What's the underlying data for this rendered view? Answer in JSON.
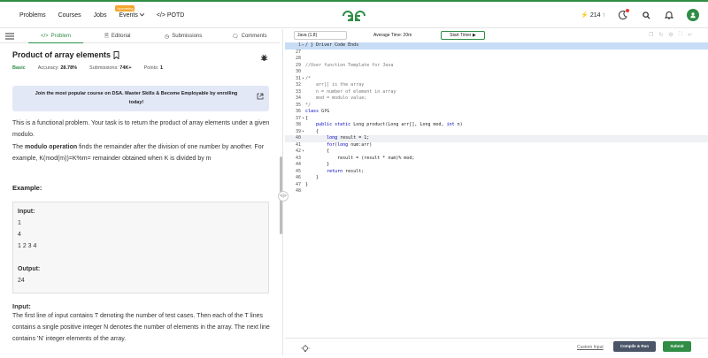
{
  "nav": {
    "items": [
      "Problems",
      "Courses",
      "Jobs"
    ],
    "events_label": "Events",
    "events_badge": "Upcoming",
    "potd_label": "POTD",
    "streak_count": "214"
  },
  "tabs": {
    "problem": "Problem",
    "editorial": "Editorial",
    "submissions": "Submissions",
    "comments": "Comments"
  },
  "problem": {
    "title": "Product of array elements",
    "difficulty": "Basic",
    "accuracy_label": "Accuracy:",
    "accuracy": "28.78%",
    "submissions_label": "Submissions:",
    "submissions": "74K+",
    "points_label": "Points:",
    "points": "1",
    "promo": "Join the most popular course on DSA. Master Skills & Become Employable by enrolling today!",
    "desc1": "This is a functional problem. Your task is to return the product of array elements under a given modulo.",
    "desc2_bold": "modulo operation",
    "desc2_pre": "The ",
    "desc2_post": " finds the remainder after the division of one number by another. For example, K(mod(m))=K%m= remainder obtained when K is divided by m",
    "example_heading": "Example:",
    "example": {
      "input_label": "Input:",
      "input_lines": [
        "1",
        "4",
        "1 2 3 4"
      ],
      "output_label": "Output:",
      "output": "24"
    },
    "input_heading": "Input:",
    "input_desc": "The first line of input contains T denoting the number of test cases. Then each of the T lines contains a single positive integer N denotes the number of elements in the array. The next line contains 'N' integer elements of the array."
  },
  "editor": {
    "language": "Java (1.8)",
    "avg_time": "Average Time: 20m",
    "timer": "Start Timer",
    "custom_input": "Custom Input",
    "compile": "Compile & Run",
    "submit": "Submit",
    "lines": [
      {
        "n": "1",
        "fold": "▸",
        "text": "/ } Driver Code Ends",
        "cls": "top"
      },
      {
        "n": "27",
        "fold": "",
        "text": ""
      },
      {
        "n": "28",
        "fold": "",
        "text": ""
      },
      {
        "n": "29",
        "fold": "",
        "text": "//User function Template for Java",
        "cm": true
      },
      {
        "n": "30",
        "fold": "",
        "text": ""
      },
      {
        "n": "31",
        "fold": "▾",
        "text": "/*",
        "cm": true
      },
      {
        "n": "32",
        "fold": "",
        "text": "    arr[] is the array",
        "cm": true
      },
      {
        "n": "33",
        "fold": "",
        "text": "    n = number of element in array",
        "cm": true
      },
      {
        "n": "34",
        "fold": "",
        "text": "    mod = modulo value;",
        "cm": true
      },
      {
        "n": "35",
        "fold": "",
        "text": "*/",
        "cm": true
      },
      {
        "n": "36",
        "fold": "",
        "text": "class GfG"
      },
      {
        "n": "37",
        "fold": "▾",
        "text": "{"
      },
      {
        "n": "38",
        "fold": "",
        "text": "    public static Long product(Long arr[], Long mod, int n)"
      },
      {
        "n": "39",
        "fold": "▾",
        "text": "    {"
      },
      {
        "n": "40",
        "fold": "",
        "text": "        long result = 1;",
        "cls": "hl"
      },
      {
        "n": "41",
        "fold": "",
        "text": "        for(long num:arr)"
      },
      {
        "n": "42",
        "fold": "▾",
        "text": "        {"
      },
      {
        "n": "43",
        "fold": "",
        "text": "            result = (result * num)% mod;"
      },
      {
        "n": "44",
        "fold": "",
        "text": "        }"
      },
      {
        "n": "45",
        "fold": "",
        "text": "        return result;"
      },
      {
        "n": "46",
        "fold": "",
        "text": "    }"
      },
      {
        "n": "47",
        "fold": "",
        "text": "}"
      },
      {
        "n": "48",
        "fold": "",
        "text": ""
      }
    ]
  },
  "colors": {
    "brand": "#2f8d46",
    "promo_bg": "#e3e8f7"
  }
}
